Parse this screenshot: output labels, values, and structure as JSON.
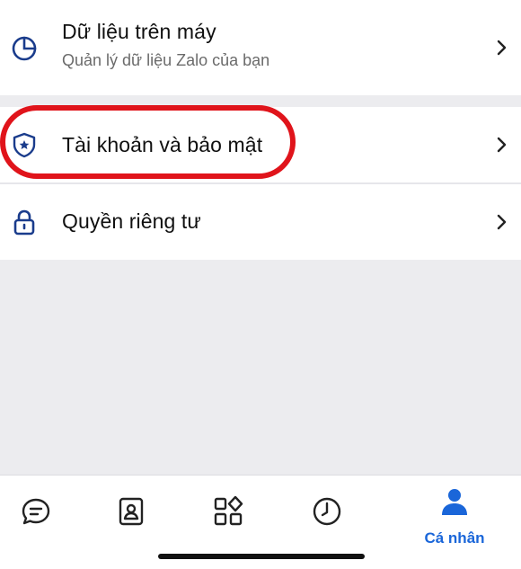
{
  "menu": {
    "data_title": "Dữ liệu trên máy",
    "data_subtitle": "Quản lý dữ liệu Zalo của bạn",
    "account_title": "Tài khoản và bảo mật",
    "privacy_title": "Quyền riêng tư"
  },
  "tabbar": {
    "active_label": "Cá nhân",
    "accent_color": "#1a66d9"
  },
  "icons": {
    "data": "pie-chart-icon",
    "account": "shield-icon",
    "privacy": "lock-icon",
    "chevron": "chevron-right-icon",
    "tabs": [
      "chat-icon",
      "contacts-icon",
      "apps-grid-icon",
      "clock-icon",
      "person-icon"
    ]
  },
  "highlight_color": "#e0141b"
}
